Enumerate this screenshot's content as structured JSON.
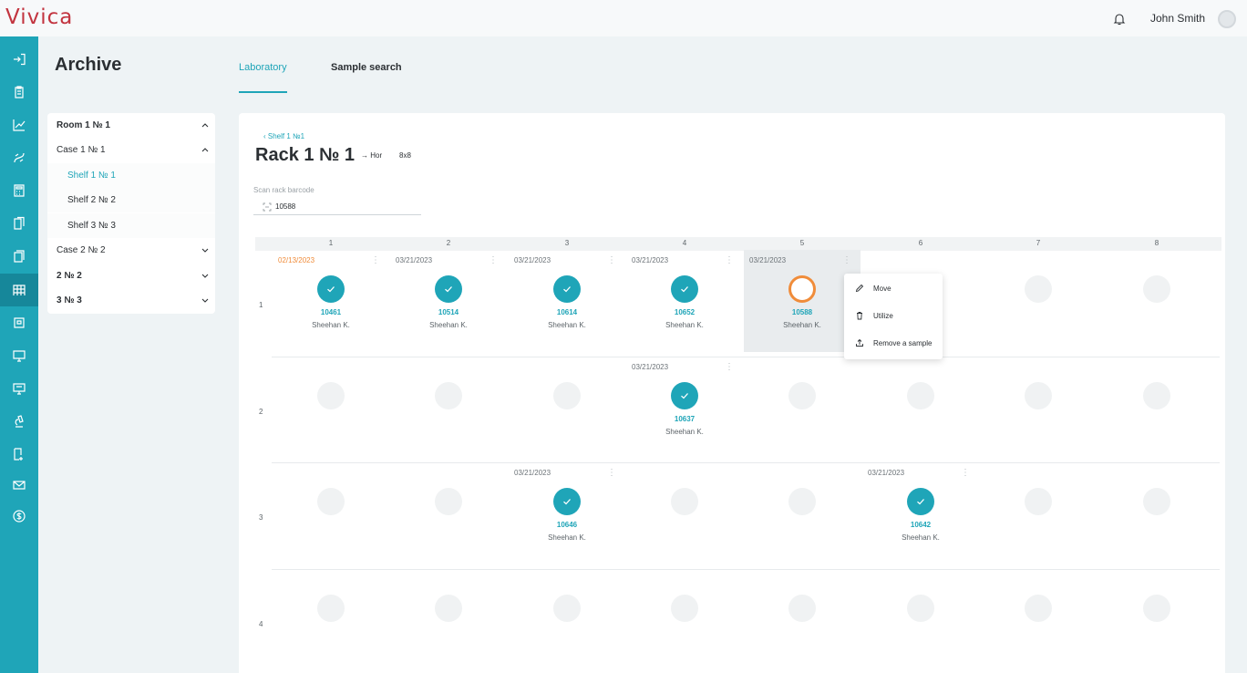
{
  "app": {
    "logo": "Vivica"
  },
  "header": {
    "user_name": "John Smith",
    "icons": [
      "bell-icon",
      "avatar"
    ]
  },
  "nav": {
    "items": [
      {
        "icon": "login-icon",
        "active": false
      },
      {
        "icon": "clipboard-icon",
        "active": false
      },
      {
        "icon": "chart-icon",
        "active": false
      },
      {
        "icon": "bio-icon",
        "active": false
      },
      {
        "icon": "calculator-icon",
        "active": false
      },
      {
        "icon": "documents-icon",
        "active": false
      },
      {
        "icon": "copy-icon",
        "active": false
      },
      {
        "icon": "archive-rack-icon",
        "active": true
      },
      {
        "icon": "register-icon",
        "active": false
      },
      {
        "icon": "monitor-icon",
        "active": false
      },
      {
        "icon": "monitor-chat-icon",
        "active": false
      },
      {
        "icon": "microscope-icon",
        "active": false
      },
      {
        "icon": "document-add-icon",
        "active": false
      },
      {
        "icon": "mail-icon",
        "active": false
      },
      {
        "icon": "dollar-icon",
        "active": false
      }
    ]
  },
  "page": {
    "title": "Archive",
    "tabs": [
      {
        "label": "Laboratory",
        "active": true
      },
      {
        "label": "Sample search",
        "active": false
      }
    ]
  },
  "tree": {
    "items": [
      {
        "label": "Room 1 № 1",
        "level": 0,
        "bold": true,
        "chevron": "up"
      },
      {
        "label": "Case 1 № 1",
        "level": 1,
        "bold": false,
        "chevron": "up"
      },
      {
        "label": "Shelf 1 № 1",
        "level": 2,
        "bold": false,
        "selected": true,
        "chevron": ""
      },
      {
        "label": "Shelf 2 № 2",
        "level": 2,
        "bold": false,
        "chevron": ""
      },
      {
        "label": "Shelf 3 № 3",
        "level": 2,
        "bold": false,
        "chevron": ""
      },
      {
        "label": "Case 2 № 2",
        "level": 1,
        "bold": false,
        "chevron": "down"
      },
      {
        "label": "2 № 2",
        "level": 0,
        "bold": true,
        "chevron": "down"
      },
      {
        "label": "3 № 3",
        "level": 0,
        "bold": true,
        "chevron": "down"
      }
    ]
  },
  "rack": {
    "back_label": "Shelf 1 №1",
    "title": "Rack 1 № 1",
    "orientation": "→ Hor",
    "size": "8x8",
    "scan_label": "Scan rack barcode",
    "scan_value": "10588",
    "columns": [
      "1",
      "2",
      "3",
      "4",
      "5",
      "6",
      "7",
      "8"
    ],
    "rows": [
      "1",
      "2",
      "3",
      "4"
    ]
  },
  "samples": [
    {
      "row": 1,
      "col": 1,
      "date": "02/13/2023",
      "overdue": true,
      "status": "done",
      "id": "10461",
      "owner": "Sheehan K."
    },
    {
      "row": 1,
      "col": 2,
      "date": "03/21/2023",
      "overdue": false,
      "status": "done",
      "id": "10514",
      "owner": "Sheehan K."
    },
    {
      "row": 1,
      "col": 3,
      "date": "03/21/2023",
      "overdue": false,
      "status": "done",
      "id": "10614",
      "owner": "Sheehan K."
    },
    {
      "row": 1,
      "col": 4,
      "date": "03/21/2023",
      "overdue": false,
      "status": "done",
      "id": "10652",
      "owner": "Sheehan K."
    },
    {
      "row": 1,
      "col": 5,
      "date": "03/21/2023",
      "overdue": false,
      "status": "pending",
      "id": "10588",
      "owner": "Sheehan K.",
      "highlighted": true
    },
    {
      "row": 2,
      "col": 4,
      "date": "03/21/2023",
      "overdue": false,
      "status": "done",
      "id": "10637",
      "owner": "Sheehan K."
    },
    {
      "row": 3,
      "col": 3,
      "date": "03/21/2023",
      "overdue": false,
      "status": "done",
      "id": "10646",
      "owner": "Sheehan K."
    },
    {
      "row": 3,
      "col": 6,
      "date": "03/21/2023",
      "overdue": false,
      "status": "done",
      "id": "10642",
      "owner": "Sheehan K."
    }
  ],
  "context_menu": {
    "items": [
      {
        "label": "Move",
        "icon": "pencil-icon"
      },
      {
        "label": "Utilize",
        "icon": "trash-icon"
      },
      {
        "label": "Remove a sample",
        "icon": "upload-icon"
      }
    ]
  },
  "colors": {
    "accent": "#1fa5b8",
    "rail": "#1fa5b8",
    "overdue": "#f08c3a",
    "brand": "#c2343f"
  }
}
